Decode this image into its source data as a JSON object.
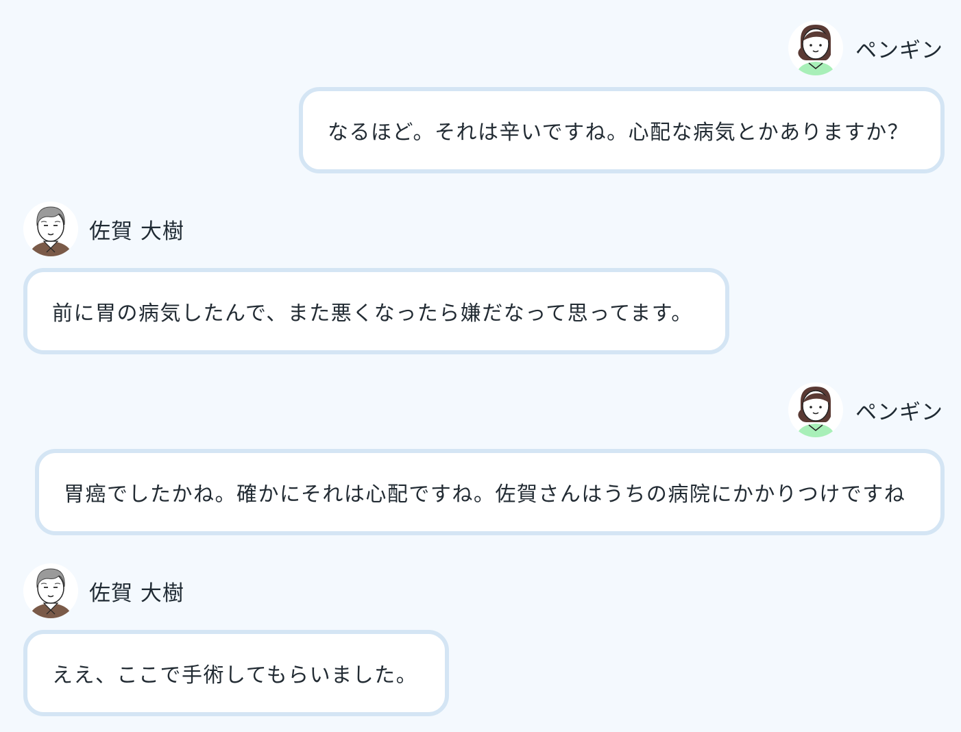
{
  "chat": {
    "messages": [
      {
        "speaker": "ペンギン",
        "side": "right",
        "avatar": "woman-avatar-icon",
        "text": "なるほど。それは辛いですね。心配な病気とかありますか？"
      },
      {
        "speaker": "佐賀 大樹",
        "side": "left",
        "avatar": "old-man-avatar-icon",
        "text": "前に胃の病気したんで、また悪くなったら嫌だなって思ってます。"
      },
      {
        "speaker": "ペンギン",
        "side": "right",
        "avatar": "woman-avatar-icon",
        "text": "胃癌でしたかね。確かにそれは心配ですね。佐賀さんはうちの病院にかかりつけですね"
      },
      {
        "speaker": "佐賀 大樹",
        "side": "left",
        "avatar": "old-man-avatar-icon",
        "text": "ええ、ここで手術してもらいました。"
      }
    ]
  },
  "colors": {
    "background": "#f4f9fe",
    "bubble_border": "#d4e5f4",
    "bubble_fill": "#ffffff",
    "woman_shirt": "#a8efb8",
    "man_sweater": "#7a5a48"
  }
}
